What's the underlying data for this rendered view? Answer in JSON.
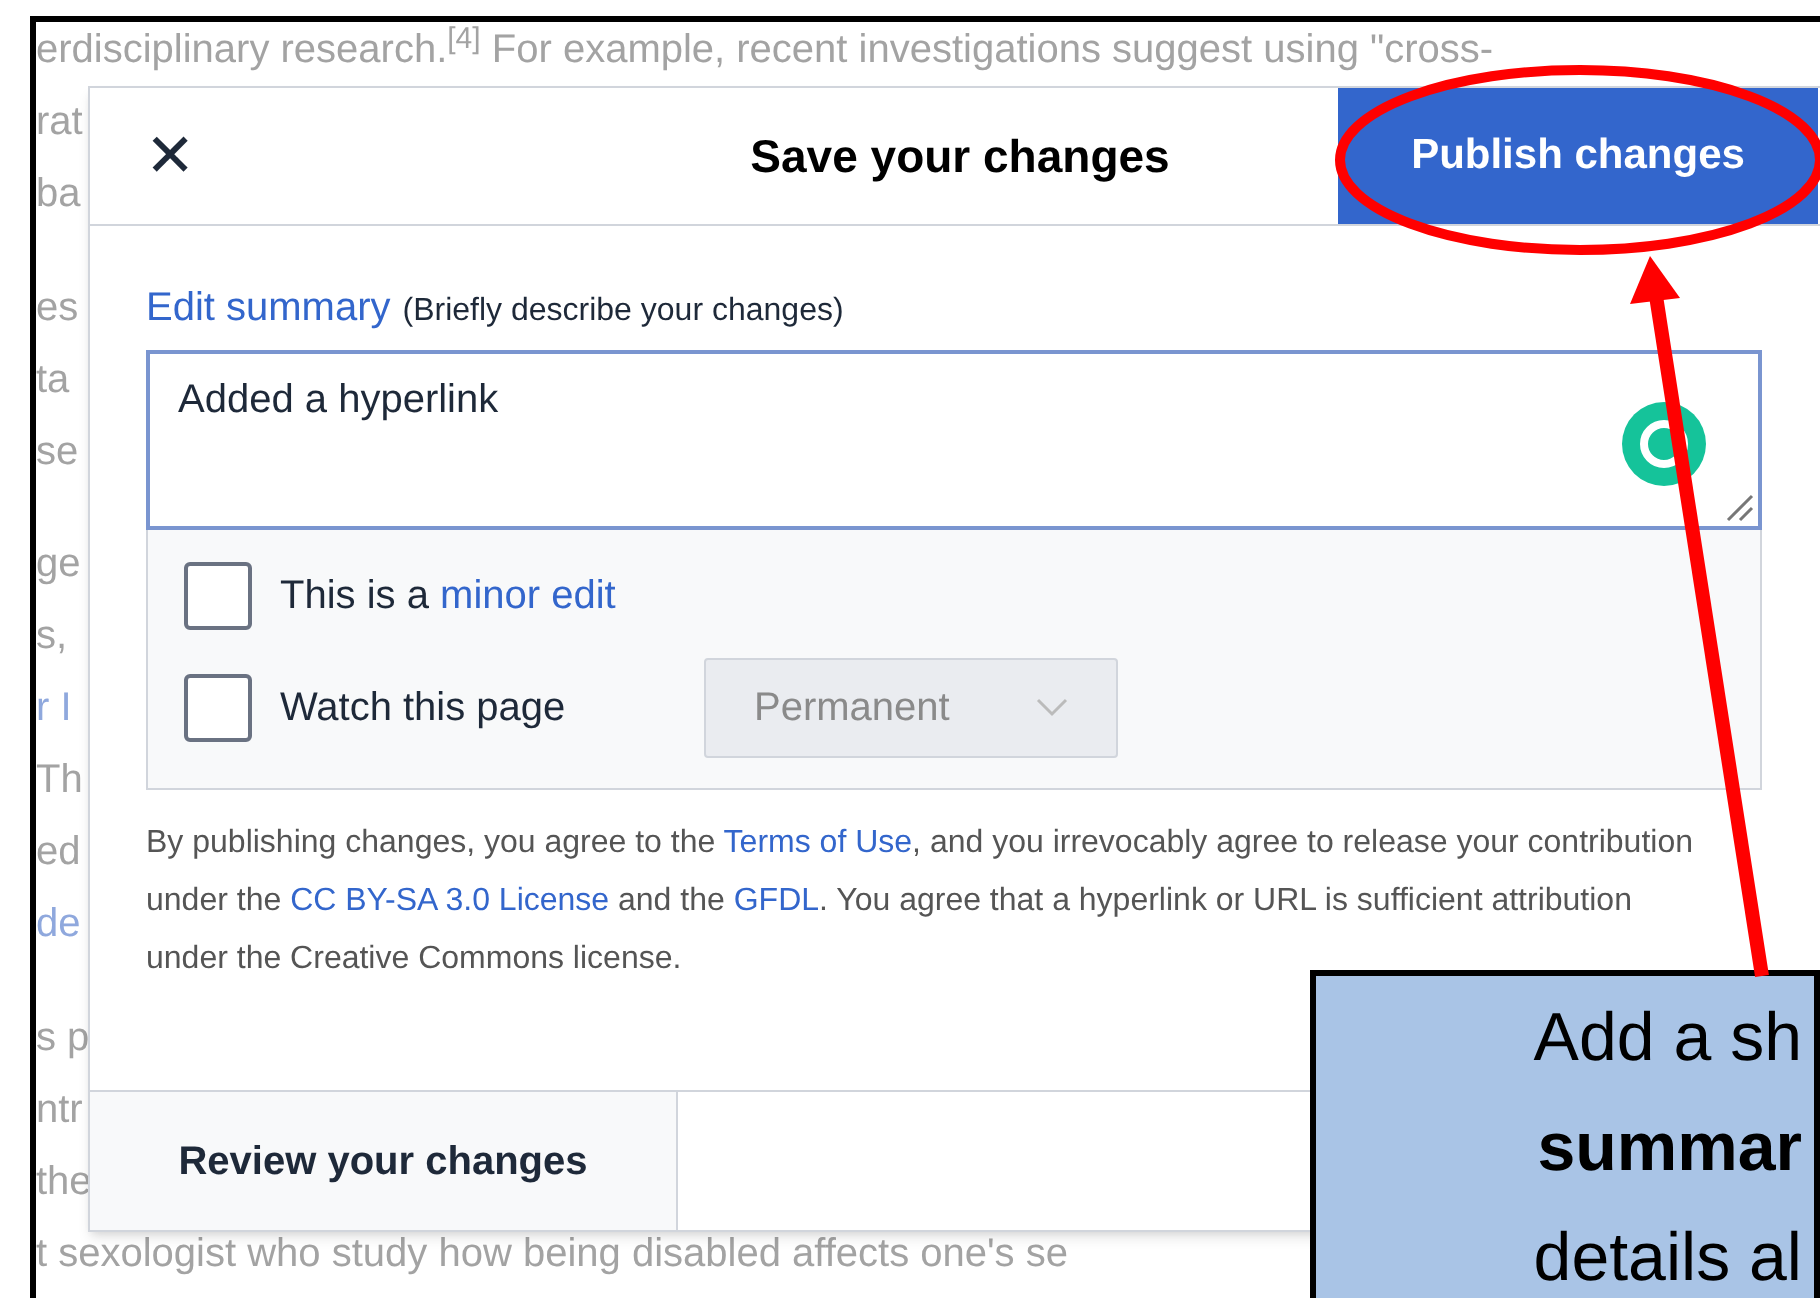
{
  "article": {
    "paragraphs": [
      {
        "lines": [
          {
            "text": "erdisciplinary research.$^{[4]}$ For example, recent investigations suggest using \"cross-",
            "kind": "text"
          },
          {
            "text": "rat",
            "kind": "text"
          },
          {
            "text": "ba",
            "kind": "text"
          }
        ]
      },
      {
        "lines": [
          {
            "text": "es",
            "kind": "text"
          },
          {
            "text": "ta",
            "kind": "text"
          },
          {
            "text": "se",
            "kind": "text"
          }
        ]
      },
      {
        "lines": [
          {
            "text": "ge",
            "kind": "text"
          },
          {
            "text": "s,",
            "kind": "text"
          },
          {
            "text": "r I",
            "kind": "link"
          },
          {
            "text": "Th",
            "kind": "text"
          },
          {
            "text": "ed",
            "kind": "text"
          },
          {
            "text": "de",
            "kind": "link"
          }
        ]
      },
      {
        "lines": [
          {
            "text": "s p",
            "kind": "text"
          },
          {
            "text": "ntr",
            "kind": "text"
          },
          {
            "text": "the",
            "kind": "text"
          },
          {
            "text": "t sexologist who study how being disabled affects one's se",
            "kind": "text"
          }
        ]
      }
    ]
  },
  "dialog": {
    "close": "✕",
    "title": "Save your changes",
    "primary_button": "Publish changes",
    "summary": {
      "label": "Edit summary",
      "hint": "(Briefly describe your changes)",
      "value": "Added a hyperlink"
    },
    "options": [
      {
        "kind": "checkbox",
        "label": "This is a",
        "link": "minor edit",
        "checked": false
      },
      {
        "kind": "checkbox",
        "label": "Watch this page",
        "checked": false,
        "dropdown": {
          "value": "Permanent",
          "disabled": true
        }
      }
    ],
    "legal": "By publishing changes, you agree to the **Terms of Use**, and you irrevocably agree to release your contribution under the **CC BY-SA 3.0 License** and the **GFDL**. You agree that a hyperlink or URL is sufficient attribution under the Creative Commons license.",
    "footer_button": "Review your changes"
  },
  "callout": {
    "lines": [
      {
        "text": "Add a sh",
        "bold": false
      },
      {
        "text": "summar",
        "bold": true
      },
      {
        "text": "details al",
        "bold": false
      }
    ]
  }
}
